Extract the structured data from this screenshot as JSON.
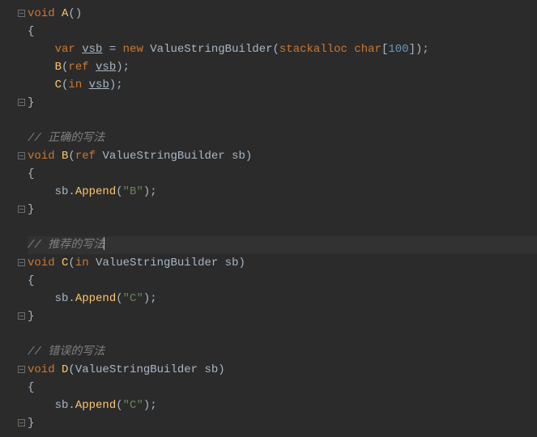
{
  "code": {
    "lines": [
      {
        "indent": 0,
        "fold": "open",
        "tokens": [
          {
            "t": "void ",
            "c": "kw"
          },
          {
            "t": "A",
            "c": "fn"
          },
          {
            "t": "(",
            "c": "par"
          },
          {
            "t": ")",
            "c": "par"
          }
        ]
      },
      {
        "indent": 0,
        "fold": null,
        "tokens": [
          {
            "t": "{",
            "c": "brace"
          }
        ]
      },
      {
        "indent": 1,
        "fold": null,
        "tokens": [
          {
            "t": "var ",
            "c": "kw"
          },
          {
            "t": "vsb",
            "c": "varu"
          },
          {
            "t": " = ",
            "c": "pun"
          },
          {
            "t": "new ",
            "c": "kw"
          },
          {
            "t": "ValueStringBuilder",
            "c": "type"
          },
          {
            "t": "(",
            "c": "par"
          },
          {
            "t": "stackalloc ",
            "c": "kw"
          },
          {
            "t": "char",
            "c": "kw"
          },
          {
            "t": "[",
            "c": "brk"
          },
          {
            "t": "100",
            "c": "num"
          },
          {
            "t": "]",
            "c": "brk"
          },
          {
            "t": ")",
            "c": "par"
          },
          {
            "t": ";",
            "c": "pun"
          }
        ]
      },
      {
        "indent": 1,
        "fold": null,
        "tokens": [
          {
            "t": "B",
            "c": "fn"
          },
          {
            "t": "(",
            "c": "par"
          },
          {
            "t": "ref ",
            "c": "kw"
          },
          {
            "t": "vsb",
            "c": "varu"
          },
          {
            "t": ")",
            "c": "par"
          },
          {
            "t": ";",
            "c": "pun"
          }
        ]
      },
      {
        "indent": 1,
        "fold": null,
        "tokens": [
          {
            "t": "C",
            "c": "fn"
          },
          {
            "t": "(",
            "c": "par"
          },
          {
            "t": "in ",
            "c": "kw"
          },
          {
            "t": "vsb",
            "c": "varu"
          },
          {
            "t": ")",
            "c": "par"
          },
          {
            "t": ";",
            "c": "pun"
          }
        ]
      },
      {
        "indent": 0,
        "fold": "close",
        "tokens": [
          {
            "t": "}",
            "c": "brace"
          }
        ]
      },
      {
        "indent": 0,
        "fold": null,
        "tokens": []
      },
      {
        "indent": 0,
        "fold": null,
        "tokens": [
          {
            "t": "// 正确的写法",
            "c": "cmt"
          }
        ]
      },
      {
        "indent": 0,
        "fold": "open",
        "tokens": [
          {
            "t": "void ",
            "c": "kw"
          },
          {
            "t": "B",
            "c": "fn"
          },
          {
            "t": "(",
            "c": "par"
          },
          {
            "t": "ref ",
            "c": "kw"
          },
          {
            "t": "ValueStringBuilder ",
            "c": "type"
          },
          {
            "t": "sb",
            "c": "var"
          },
          {
            "t": ")",
            "c": "par"
          }
        ]
      },
      {
        "indent": 0,
        "fold": null,
        "tokens": [
          {
            "t": "{",
            "c": "brace"
          }
        ]
      },
      {
        "indent": 1,
        "fold": null,
        "tokens": [
          {
            "t": "sb",
            "c": "var"
          },
          {
            "t": ".",
            "c": "pun"
          },
          {
            "t": "Append",
            "c": "fn"
          },
          {
            "t": "(",
            "c": "par"
          },
          {
            "t": "\"B\"",
            "c": "str"
          },
          {
            "t": ")",
            "c": "par"
          },
          {
            "t": ";",
            "c": "pun"
          }
        ]
      },
      {
        "indent": 0,
        "fold": "close",
        "tokens": [
          {
            "t": "}",
            "c": "brace"
          }
        ]
      },
      {
        "indent": 0,
        "fold": null,
        "tokens": []
      },
      {
        "indent": 0,
        "fold": null,
        "highlight": true,
        "caret": true,
        "tokens": [
          {
            "t": "// 推荐的写法",
            "c": "cmt"
          }
        ]
      },
      {
        "indent": 0,
        "fold": "open",
        "tokens": [
          {
            "t": "void ",
            "c": "kw"
          },
          {
            "t": "C",
            "c": "fn"
          },
          {
            "t": "(",
            "c": "par"
          },
          {
            "t": "in ",
            "c": "kw"
          },
          {
            "t": "ValueStringBuilder ",
            "c": "type"
          },
          {
            "t": "sb",
            "c": "var"
          },
          {
            "t": ")",
            "c": "par"
          }
        ]
      },
      {
        "indent": 0,
        "fold": null,
        "tokens": [
          {
            "t": "{",
            "c": "brace"
          }
        ]
      },
      {
        "indent": 1,
        "fold": null,
        "tokens": [
          {
            "t": "sb",
            "c": "var"
          },
          {
            "t": ".",
            "c": "pun"
          },
          {
            "t": "Append",
            "c": "fn"
          },
          {
            "t": "(",
            "c": "par"
          },
          {
            "t": "\"C\"",
            "c": "str"
          },
          {
            "t": ")",
            "c": "par"
          },
          {
            "t": ";",
            "c": "pun"
          }
        ]
      },
      {
        "indent": 0,
        "fold": "close",
        "tokens": [
          {
            "t": "}",
            "c": "brace"
          }
        ]
      },
      {
        "indent": 0,
        "fold": null,
        "tokens": []
      },
      {
        "indent": 0,
        "fold": null,
        "tokens": [
          {
            "t": "// 错误的写法",
            "c": "cmt"
          }
        ]
      },
      {
        "indent": 0,
        "fold": "open",
        "tokens": [
          {
            "t": "void ",
            "c": "kw"
          },
          {
            "t": "D",
            "c": "fn"
          },
          {
            "t": "(",
            "c": "par"
          },
          {
            "t": "ValueStringBuilder ",
            "c": "type"
          },
          {
            "t": "sb",
            "c": "var"
          },
          {
            "t": ")",
            "c": "par"
          }
        ]
      },
      {
        "indent": 0,
        "fold": null,
        "tokens": [
          {
            "t": "{",
            "c": "brace"
          }
        ]
      },
      {
        "indent": 1,
        "fold": null,
        "tokens": [
          {
            "t": "sb",
            "c": "var"
          },
          {
            "t": ".",
            "c": "pun"
          },
          {
            "t": "Append",
            "c": "fn"
          },
          {
            "t": "(",
            "c": "par"
          },
          {
            "t": "\"C\"",
            "c": "str"
          },
          {
            "t": ")",
            "c": "par"
          },
          {
            "t": ";",
            "c": "pun"
          }
        ]
      },
      {
        "indent": 0,
        "fold": "close",
        "tokens": [
          {
            "t": "}",
            "c": "brace"
          }
        ]
      }
    ]
  },
  "colors": {
    "background": "#2b2b2b",
    "foreground": "#a9b7c6",
    "keyword": "#cc7832",
    "function": "#ffc66d",
    "number": "#6897bb",
    "string": "#6a8759",
    "comment": "#808080",
    "fold": "#6e6e6e",
    "highlight": "#323232"
  }
}
